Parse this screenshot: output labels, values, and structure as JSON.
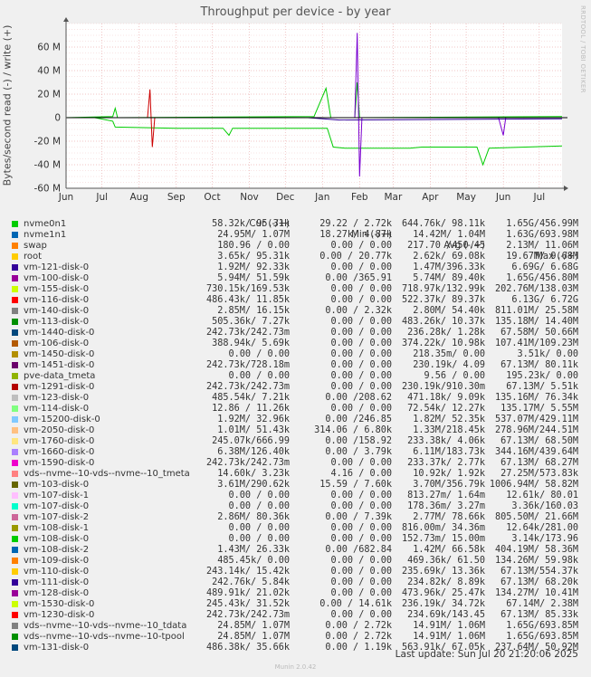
{
  "chart_data": {
    "type": "line",
    "title": "Throughput per device - by year",
    "ylabel": "Bytes/second read (-) / write (+)",
    "ylim": [
      -60,
      80
    ],
    "yticks": [
      "60 M",
      "40 M",
      "20 M",
      "0",
      "-20 M",
      "-40 M",
      "-60 M"
    ],
    "ytick_values": [
      60,
      40,
      20,
      0,
      -20,
      -40,
      -60
    ],
    "xticks": [
      "Jun",
      "Jul",
      "Aug",
      "Sep",
      "Oct",
      "Nov",
      "Dec",
      "Jan",
      "Feb",
      "Mar",
      "Apr",
      "May",
      "Jun",
      "Jul"
    ],
    "x_start": "2024-06-01",
    "x_end": "2025-07-20",
    "series": [
      {
        "color": "#00cc00",
        "points": [
          [
            "2024-06-25",
            0
          ],
          [
            "2024-07-10",
            -3
          ],
          [
            "2024-07-12",
            -8
          ],
          [
            "2024-09-01",
            -9
          ],
          [
            "2024-10-10",
            -9
          ],
          [
            "2024-10-15",
            -15
          ],
          [
            "2024-10-18",
            -9
          ],
          [
            "2024-12-15",
            -9
          ],
          [
            "2025-01-05",
            -9
          ],
          [
            "2025-01-10",
            -25
          ],
          [
            "2025-01-20",
            -26
          ],
          [
            "2025-02-15",
            -26
          ],
          [
            "2025-03-15",
            -26
          ],
          [
            "2025-03-25",
            -25
          ],
          [
            "2025-05-10",
            -25
          ],
          [
            "2025-05-15",
            -40
          ],
          [
            "2025-05-20",
            -26
          ],
          [
            "2025-07-20",
            -24
          ]
        ]
      },
      {
        "color": "#00cc00",
        "points": [
          [
            "2024-06-01",
            0
          ],
          [
            "2024-07-10",
            1
          ],
          [
            "2024-07-12",
            8
          ],
          [
            "2024-07-14",
            0
          ],
          [
            "2024-12-25",
            1
          ],
          [
            "2025-01-04",
            25
          ],
          [
            "2025-01-08",
            0
          ],
          [
            "2025-01-28",
            0
          ],
          [
            "2025-01-30",
            30
          ],
          [
            "2025-02-01",
            0
          ],
          [
            "2025-07-20",
            1
          ]
        ]
      },
      {
        "color": "#cc0000",
        "points": [
          [
            "2024-08-08",
            0
          ],
          [
            "2024-08-10",
            24
          ],
          [
            "2024-08-12",
            -25
          ],
          [
            "2024-08-14",
            0
          ]
        ]
      },
      {
        "color": "#7a00d0",
        "points": [
          [
            "2025-01-15",
            0
          ],
          [
            "2025-01-28",
            0
          ],
          [
            "2025-01-30",
            72
          ],
          [
            "2025-02-01",
            -50
          ],
          [
            "2025-02-03",
            0
          ],
          [
            "2025-05-28",
            0
          ],
          [
            "2025-06-01",
            -15
          ],
          [
            "2025-06-03",
            0
          ]
        ]
      },
      {
        "color": "#0066b3",
        "points": [
          [
            "2024-06-01",
            0
          ],
          [
            "2025-07-20",
            0
          ]
        ]
      },
      {
        "color": "#330099",
        "points": [
          [
            "2024-12-20",
            0
          ],
          [
            "2025-01-15",
            -2
          ],
          [
            "2025-07-20",
            -1
          ]
        ]
      }
    ]
  },
  "legend": {
    "headers": {
      "cur": "Cur (-/+)",
      "min": "Min (-/+)",
      "avg": "Avg (-/+)",
      "max": "Max (-/+)"
    },
    "rows": [
      {
        "name": "nvme0n1",
        "color": "#00cc00",
        "cur": "58.32k/ 95.31k",
        "min": "29.22 / 2.72k",
        "avg": "644.76k/ 98.11k",
        "max": "1.65G/456.99M"
      },
      {
        "name": "nvme1n1",
        "color": "#0066b3",
        "cur": "24.95M/ 1.07M",
        "min": "18.27k/ 4.87k",
        "avg": "14.42M/ 1.04M",
        "max": "1.63G/693.98M"
      },
      {
        "name": "swap",
        "color": "#ff8000",
        "cur": "180.96 / 0.00",
        "min": "0.00 / 0.00",
        "avg": "217.70 /450.45",
        "max": "2.13M/ 11.06M"
      },
      {
        "name": "root",
        "color": "#ffcc00",
        "cur": "3.65k/ 95.31k",
        "min": "0.00 / 20.77k",
        "avg": "2.62k/ 69.08k",
        "max": "19.67M/ 9.68M"
      },
      {
        "name": "vm-121-disk-0",
        "color": "#330099",
        "cur": "1.92M/ 92.33k",
        "min": "0.00 / 0.00",
        "avg": "1.47M/396.33k",
        "max": "6.69G/ 6.68G"
      },
      {
        "name": "vm-100-disk-0",
        "color": "#990099",
        "cur": "5.94M/ 51.59k",
        "min": "0.00 /365.91",
        "avg": "5.74M/ 89.40k",
        "max": "1.65G/456.80M"
      },
      {
        "name": "vm-155-disk-0",
        "color": "#ccff00",
        "cur": "730.15k/169.53k",
        "min": "0.00 / 0.00",
        "avg": "718.97k/132.99k",
        "max": "202.76M/138.03M"
      },
      {
        "name": "vm-116-disk-0",
        "color": "#ff0000",
        "cur": "486.43k/ 11.85k",
        "min": "0.00 / 0.00",
        "avg": "522.37k/ 89.37k",
        "max": "6.13G/ 6.72G"
      },
      {
        "name": "vm-140-disk-0",
        "color": "#808080",
        "cur": "2.85M/ 16.15k",
        "min": "0.00 / 2.32k",
        "avg": "2.80M/ 54.40k",
        "max": "811.01M/ 25.58M"
      },
      {
        "name": "vm-113-disk-0",
        "color": "#008f00",
        "cur": "505.36k/ 7.27k",
        "min": "0.00 / 0.00",
        "avg": "483.26k/ 10.37k",
        "max": "135.18M/ 14.40M"
      },
      {
        "name": "vm-1440-disk-0",
        "color": "#00487d",
        "cur": "242.73k/242.73m",
        "min": "0.00 / 0.00",
        "avg": "236.28k/ 1.28k",
        "max": "67.58M/ 50.66M"
      },
      {
        "name": "vm-106-disk-0",
        "color": "#b35a00",
        "cur": "388.94k/ 5.69k",
        "min": "0.00 / 0.00",
        "avg": "374.22k/ 10.98k",
        "max": "107.41M/109.23M"
      },
      {
        "name": "vm-1450-disk-0",
        "color": "#b38f00",
        "cur": "0.00 / 0.00",
        "min": "0.00 / 0.00",
        "avg": "218.35m/ 0.00",
        "max": "3.51k/ 0.00"
      },
      {
        "name": "vm-1451-disk-0",
        "color": "#6b006b",
        "cur": "242.73k/728.18m",
        "min": "0.00 / 0.00",
        "avg": "230.19k/ 4.09",
        "max": "67.13M/ 80.11k"
      },
      {
        "name": "pve-data_tmeta",
        "color": "#8fb300",
        "cur": "0.00 / 0.00",
        "min": "0.00 / 0.00",
        "avg": "9.56 / 0.00",
        "max": "195.23k/ 0.00"
      },
      {
        "name": "vm-1291-disk-0",
        "color": "#b30000",
        "cur": "242.73k/242.73m",
        "min": "0.00 / 0.00",
        "avg": "230.19k/910.30m",
        "max": "67.13M/ 5.51k"
      },
      {
        "name": "vm-123-disk-0",
        "color": "#bebebe",
        "cur": "485.54k/ 7.21k",
        "min": "0.00 /208.62",
        "avg": "471.18k/ 9.09k",
        "max": "135.16M/ 76.34k"
      },
      {
        "name": "vm-114-disk-0",
        "color": "#80ff80",
        "cur": "12.86 / 11.26k",
        "min": "0.00 / 0.00",
        "avg": "72.54k/ 12.27k",
        "max": "135.17M/ 5.55M"
      },
      {
        "name": "vm-15200-disk-0",
        "color": "#80c9ff",
        "cur": "1.92M/ 32.96k",
        "min": "0.00 /246.85",
        "avg": "1.82M/ 52.35k",
        "max": "537.07M/429.11M"
      },
      {
        "name": "vm-2050-disk-0",
        "color": "#ffc080",
        "cur": "1.01M/ 51.43k",
        "min": "314.06 / 6.80k",
        "avg": "1.33M/218.45k",
        "max": "278.96M/244.51M"
      },
      {
        "name": "vm-1760-disk-0",
        "color": "#ffe680",
        "cur": "245.07k/666.99",
        "min": "0.00 /158.92",
        "avg": "233.38k/ 4.06k",
        "max": "67.13M/ 68.50M"
      },
      {
        "name": "vm-1660-disk-0",
        "color": "#aa80ff",
        "cur": "6.38M/126.40k",
        "min": "0.00 / 3.79k",
        "avg": "6.11M/183.73k",
        "max": "344.16M/439.64M"
      },
      {
        "name": "vm-1590-disk-0",
        "color": "#ee00cc",
        "cur": "242.73k/242.73m",
        "min": "0.00 / 0.00",
        "avg": "233.37k/ 2.77k",
        "max": "67.13M/ 68.27M"
      },
      {
        "name": "vds--nvme--10-vds--nvme--10_tmeta",
        "color": "#ff8080",
        "cur": "14.60k/ 3.23k",
        "min": "4.16 / 0.00",
        "avg": "10.92k/ 1.92k",
        "max": "27.25M/573.83k"
      },
      {
        "name": "vm-103-disk-0",
        "color": "#666600",
        "cur": "3.61M/290.62k",
        "min": "15.59 / 7.60k",
        "avg": "3.70M/356.79k",
        "max": "1006.94M/ 58.82M"
      },
      {
        "name": "vm-107-disk-1",
        "color": "#ffbfff",
        "cur": "0.00 / 0.00",
        "min": "0.00 / 0.00",
        "avg": "813.27m/ 1.64m",
        "max": "12.61k/ 80.01"
      },
      {
        "name": "vm-107-disk-0",
        "color": "#00ffcc",
        "cur": "0.00 / 0.00",
        "min": "0.00 / 0.00",
        "avg": "178.36m/ 3.27m",
        "max": "3.36k/160.03"
      },
      {
        "name": "vm-107-disk-2",
        "color": "#cc6699",
        "cur": "2.86M/ 80.36k",
        "min": "0.00 / 7.39k",
        "avg": "2.77M/ 78.66k",
        "max": "805.50M/ 21.66M"
      },
      {
        "name": "vm-108-disk-1",
        "color": "#999900",
        "cur": "0.00 / 0.00",
        "min": "0.00 / 0.00",
        "avg": "816.00m/ 34.36m",
        "max": "12.64k/281.00"
      },
      {
        "name": "vm-108-disk-0",
        "color": "#00cc00",
        "cur": "0.00 / 0.00",
        "min": "0.00 / 0.00",
        "avg": "152.73m/ 15.00m",
        "max": "3.14k/173.96"
      },
      {
        "name": "vm-108-disk-2",
        "color": "#0066b3",
        "cur": "1.43M/ 26.33k",
        "min": "0.00 /682.84",
        "avg": "1.42M/ 66.58k",
        "max": "404.19M/ 58.36M"
      },
      {
        "name": "vm-109-disk-0",
        "color": "#ff8000",
        "cur": "485.45k/ 0.00",
        "min": "0.00 / 0.00",
        "avg": "469.36k/ 61.50",
        "max": "134.26M/ 59.98k"
      },
      {
        "name": "vm-110-disk-0",
        "color": "#ffcc00",
        "cur": "243.14k/ 15.42k",
        "min": "0.00 / 0.00",
        "avg": "235.69k/ 13.36k",
        "max": "67.13M/554.37k"
      },
      {
        "name": "vm-111-disk-0",
        "color": "#330099",
        "cur": "242.76k/ 5.84k",
        "min": "0.00 / 0.00",
        "avg": "234.82k/ 8.89k",
        "max": "67.13M/ 68.20k"
      },
      {
        "name": "vm-128-disk-0",
        "color": "#990099",
        "cur": "489.91k/ 21.02k",
        "min": "0.00 / 0.00",
        "avg": "473.96k/ 25.47k",
        "max": "134.27M/ 10.41M"
      },
      {
        "name": "vm-1530-disk-0",
        "color": "#ccff00",
        "cur": "245.43k/ 31.52k",
        "min": "0.00 / 14.61k",
        "avg": "236.19k/ 34.72k",
        "max": "67.14M/ 2.38M"
      },
      {
        "name": "vm-1230-disk-0",
        "color": "#ff0000",
        "cur": "242.73k/242.73m",
        "min": "0.00 / 0.00",
        "avg": "234.69k/143.45",
        "max": "67.13M/ 85.33k"
      },
      {
        "name": "vds--nvme--10-vds--nvme--10_tdata",
        "color": "#808080",
        "cur": "24.85M/ 1.07M",
        "min": "0.00 / 2.72k",
        "avg": "14.91M/ 1.06M",
        "max": "1.65G/693.85M"
      },
      {
        "name": "vds--nvme--10-vds--nvme--10-tpool",
        "color": "#008f00",
        "cur": "24.85M/ 1.07M",
        "min": "0.00 / 2.72k",
        "avg": "14.91M/ 1.06M",
        "max": "1.65G/693.85M"
      },
      {
        "name": "vm-131-disk-0",
        "color": "#00487d",
        "cur": "486.38k/ 35.66k",
        "min": "0.00 / 1.19k",
        "avg": "563.91k/ 67.05k",
        "max": "237.64M/ 50.92M"
      }
    ]
  },
  "last_update": "Last update: Sun Jul 20 21:20:06 2025",
  "rrdtool_credit": "RRDTOOL / TOBI OETIKER",
  "footer": "Munin 2.0.42"
}
